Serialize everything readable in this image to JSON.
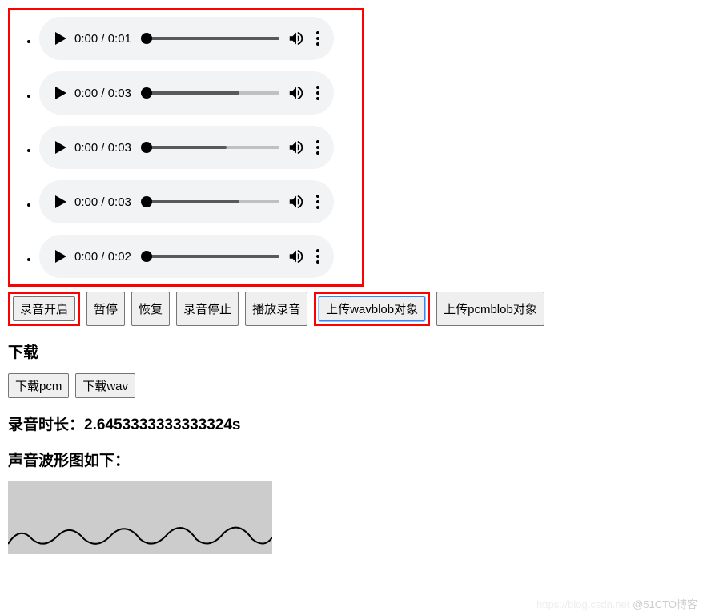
{
  "audio_players": [
    {
      "current": "0:00",
      "duration": "0:01",
      "progress": 0,
      "buffered": 100
    },
    {
      "current": "0:00",
      "duration": "0:03",
      "progress": 0,
      "buffered": 70
    },
    {
      "current": "0:00",
      "duration": "0:03",
      "progress": 0,
      "buffered": 60
    },
    {
      "current": "0:00",
      "duration": "0:03",
      "progress": 0,
      "buffered": 70
    },
    {
      "current": "0:00",
      "duration": "0:02",
      "progress": 0,
      "buffered": 100
    }
  ],
  "buttons": {
    "record_start": "录音开启",
    "pause": "暂停",
    "resume": "恢复",
    "record_stop": "录音停止",
    "play_record": "播放录音",
    "upload_wav": "上传wavblob对象",
    "upload_pcm": "上传pcmblob对象",
    "download_pcm": "下载pcm",
    "download_wav": "下载wav"
  },
  "headings": {
    "download": "下载",
    "duration_prefix": "录音时长：",
    "duration_value": "2.6453333333333324s",
    "waveform": "声音波形图如下："
  },
  "watermark": "@51CTO博客",
  "watermark_faint": "https://blog.csdn.net"
}
